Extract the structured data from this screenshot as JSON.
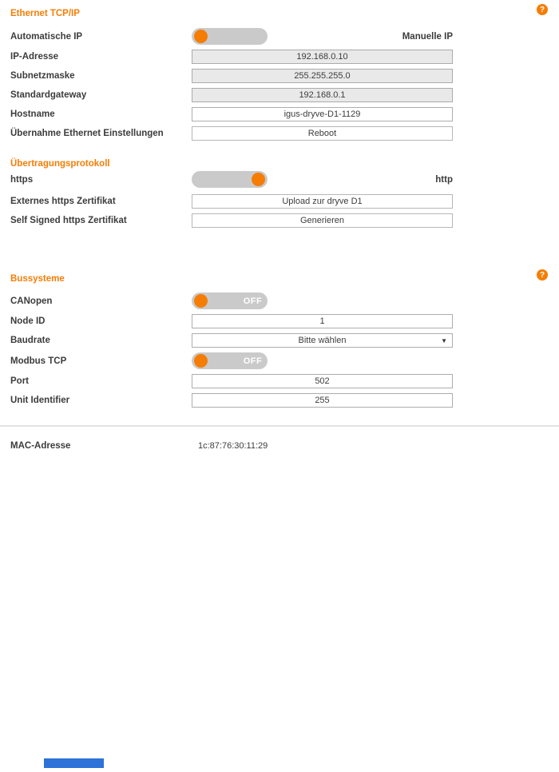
{
  "colors": {
    "accent": "#f57d05",
    "toggle_track": "#cacaca",
    "field_disabled_bg": "#e9e9e9",
    "footer_bar": "#2c72d9"
  },
  "icons": {
    "help": "?",
    "dropdown_arrow": "▼"
  },
  "sections": {
    "ethernet": {
      "title": "Ethernet TCP/IP",
      "auto_ip": {
        "label": "Automatische IP",
        "right_label": "Manuelle IP",
        "state": "automatic"
      },
      "ip_address": {
        "label": "IP-Adresse",
        "value": "192.168.0.10"
      },
      "subnet_mask": {
        "label": "Subnetzmaske",
        "value": "255.255.255.0"
      },
      "gateway": {
        "label": "Standardgateway",
        "value": "192.168.0.1"
      },
      "hostname": {
        "label": "Hostname",
        "value": "igus-dryve-D1-1129"
      },
      "apply": {
        "label": "Übernahme Ethernet Einstellungen",
        "button_label": "Reboot"
      }
    },
    "protocol": {
      "title": "Übertragungsprotokoll",
      "https_toggle": {
        "label": "https",
        "right_label": "http",
        "state": "http"
      },
      "external_cert": {
        "label": "Externes https Zertifikat",
        "button_label": "Upload zur dryve D1"
      },
      "self_signed_cert": {
        "label": "Self Signed https Zertifikat",
        "button_label": "Generieren"
      }
    },
    "bus": {
      "title": "Bussysteme",
      "canopen": {
        "label": "CANopen",
        "state_label": "OFF"
      },
      "node_id": {
        "label": "Node ID",
        "value": "1"
      },
      "baudrate": {
        "label": "Baudrate",
        "value": "Bitte wählen"
      },
      "modbus": {
        "label": "Modbus TCP",
        "state_label": "OFF"
      },
      "port": {
        "label": "Port",
        "value": "502"
      },
      "unit_identifier": {
        "label": "Unit Identifier",
        "value": "255"
      }
    },
    "info": {
      "mac": {
        "label": "MAC-Adresse",
        "value": "1c:87:76:30:11:29"
      }
    }
  }
}
